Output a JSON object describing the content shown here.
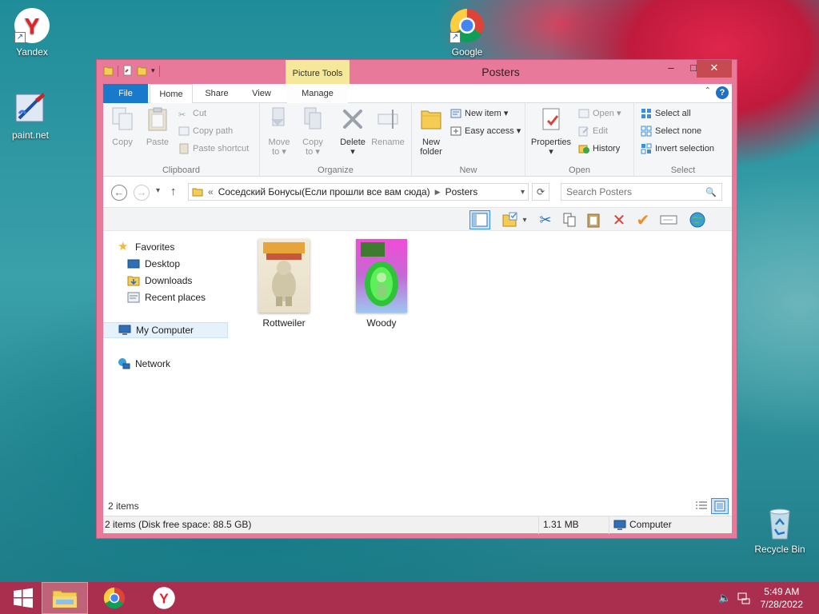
{
  "desktop": {
    "icons": [
      {
        "label": "Yandex",
        "icon": "yandex-icon"
      },
      {
        "label": "Google",
        "icon": "chrome-icon"
      },
      {
        "label": "paint.net",
        "icon": "paintnet-icon"
      },
      {
        "label": "Recycle Bin",
        "icon": "recycle-bin-icon"
      }
    ]
  },
  "window": {
    "title": "Posters",
    "context_tab": "Picture Tools",
    "controls": {
      "minimize": "–",
      "maximize": "□",
      "close": "✕"
    },
    "tabs": [
      "File",
      "Home",
      "Share",
      "View",
      "Manage"
    ],
    "ribbon": {
      "clipboard": {
        "label": "Clipboard",
        "copy": "Copy",
        "paste": "Paste",
        "cut": "Cut",
        "copy_path": "Copy path",
        "paste_shortcut": "Paste shortcut"
      },
      "organize": {
        "label": "Organize",
        "move_to": [
          "Move",
          "to ▾"
        ],
        "copy_to": [
          "Copy",
          "to ▾"
        ],
        "delete": [
          "Delete",
          "▾"
        ],
        "rename": "Rename"
      },
      "new": {
        "label": "New",
        "new_folder": [
          "New",
          "folder"
        ],
        "new_item": "New item ▾",
        "easy_access": "Easy access ▾"
      },
      "open": {
        "label": "Open",
        "properties": [
          "Properties",
          "▾"
        ],
        "open": "Open ▾",
        "edit": "Edit",
        "history": "History"
      },
      "select": {
        "label": "Select",
        "select_all": "Select all",
        "select_none": "Select none",
        "invert_selection": "Invert selection"
      }
    },
    "address": {
      "back": "←",
      "forward": "→",
      "recent": "▾",
      "up": "↑",
      "chevron": "«",
      "crumbs": [
        "Соседский Бонусы(Если прошли все вам сюда)",
        "Posters"
      ],
      "dropdown": "▾",
      "refresh": "⟳",
      "search_placeholder": "Search Posters",
      "search_icon": "🔍"
    },
    "nav": {
      "favorites": "Favorites",
      "desktop": "Desktop",
      "downloads": "Downloads",
      "recent_places": "Recent places",
      "my_computer": "My Computer",
      "network": "Network"
    },
    "files": [
      {
        "name": "Rottweiler"
      },
      {
        "name": "Woody"
      }
    ],
    "status": {
      "item_count": "2 items",
      "details": "2 items (Disk free space: 88.5 GB)",
      "size": "1.31 MB",
      "location": "Computer"
    }
  },
  "taskbar": {
    "time": "5:49 AM",
    "date": "7/28/2022"
  }
}
